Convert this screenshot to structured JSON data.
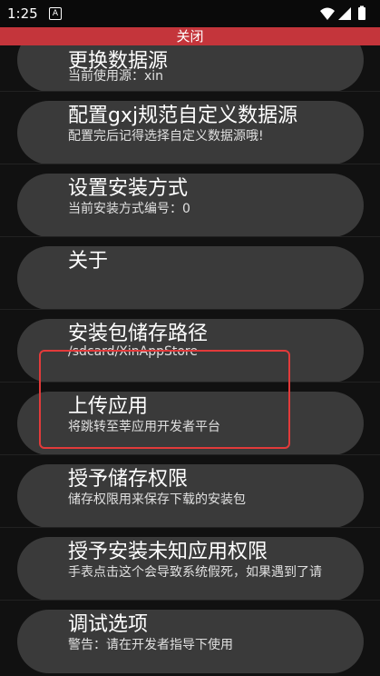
{
  "status": {
    "time": "1:25",
    "badge": "A"
  },
  "close_bar": {
    "label": "关闭",
    "color": "#c4353b"
  },
  "settings": [
    {
      "title": "更换数据源",
      "subtitle": "当前使用源：xin"
    },
    {
      "title": "配置gxj规范自定义数据源",
      "subtitle": "配置完后记得选择自定义数据源哦!"
    },
    {
      "title": "设置安装方式",
      "subtitle": "当前安装方式编号：0"
    },
    {
      "title": "关于",
      "subtitle": ""
    },
    {
      "title": "安装包储存路径",
      "subtitle": "/sdcard/XinAppStore"
    },
    {
      "title": "上传应用",
      "subtitle": "将跳转至莘应用开发者平台"
    },
    {
      "title": "授予储存权限",
      "subtitle": "储存权限用来保存下载的安装包"
    },
    {
      "title": "授予安装未知应用权限",
      "subtitle": "手表点击这个会导致系统假死，如果遇到了请"
    },
    {
      "title": "调试选项",
      "subtitle": "警告：请在开发者指导下使用"
    }
  ],
  "icons": {
    "wifi": "wifi-icon",
    "signal": "signal-icon",
    "battery": "battery-icon"
  },
  "colors": {
    "highlight": "#e23a3a",
    "card": "#3a3a3a",
    "background": "#111111"
  }
}
